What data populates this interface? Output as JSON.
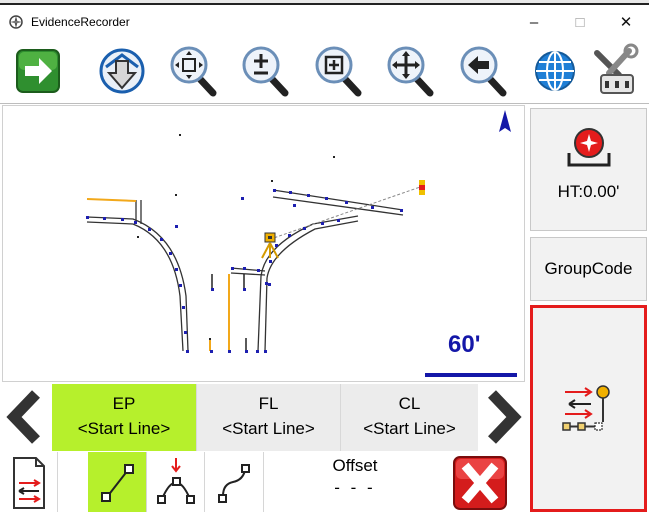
{
  "window": {
    "title": "EvidenceRecorder",
    "controls": [
      "–",
      "□",
      "✕"
    ]
  },
  "toolbar": {
    "buttons": [
      {
        "name": "go-arrow-button",
        "icon": "right-arrow-icon",
        "color": "#2f8f2f"
      },
      {
        "name": "download-button",
        "icon": "down-arrow-icon",
        "color": "#1a5fae"
      },
      {
        "name": "zoom-extents-button",
        "icon": "zoom-extents-icon"
      },
      {
        "name": "zoom-in-out-button",
        "icon": "zoom-plus-minus-icon"
      },
      {
        "name": "zoom-window-button",
        "icon": "zoom-window-icon"
      },
      {
        "name": "pan-button",
        "icon": "pan-icon"
      },
      {
        "name": "zoom-previous-button",
        "icon": "zoom-back-icon"
      },
      {
        "name": "globe-button",
        "icon": "globe-icon",
        "color": "#1f7fd6"
      },
      {
        "name": "settings-button",
        "icon": "tools-icon"
      }
    ]
  },
  "map": {
    "scale_label": "60'",
    "scale_color": "#1417a8",
    "north_arrow": "north-arrow-icon"
  },
  "right_panel": {
    "height_label": "HT:0.00'",
    "groupcode_label": "GroupCode",
    "highlight_color": "#e41c1c"
  },
  "codes": [
    {
      "name": "EP",
      "sub": "<Start Line>",
      "active": true
    },
    {
      "name": "FL",
      "sub": "<Start Line>",
      "active": false
    },
    {
      "name": "CL",
      "sub": "<Start Line>",
      "active": false
    }
  ],
  "active_code_color": "#b6f02c",
  "bottom": {
    "offset_title": "Offset",
    "offset_value": "- - -"
  }
}
